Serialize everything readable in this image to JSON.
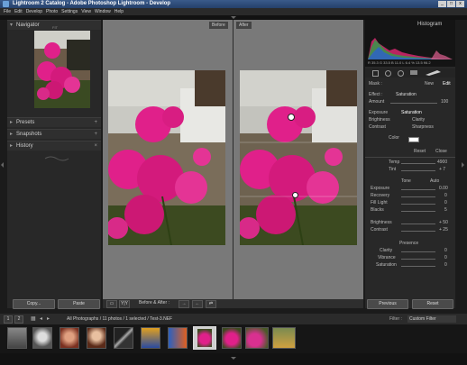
{
  "window": {
    "title": "Lightroom 2 Catalog - Adobe Photoshop Lightroom - Develop"
  },
  "menu": [
    "File",
    "Edit",
    "Develop",
    "Photo",
    "Settings",
    "View",
    "Window",
    "Help"
  ],
  "left_panel": {
    "navigator": {
      "label": "Navigator",
      "zoom": "FIT"
    },
    "sections": [
      {
        "label": "Presets"
      },
      {
        "label": "Snapshots"
      },
      {
        "label": "History"
      }
    ],
    "copy_label": "Copy...",
    "paste_label": "Paste"
  },
  "main": {
    "before_label": "Before",
    "after_label": "After"
  },
  "toolbar": {
    "compare_label": "Before & After :"
  },
  "right_panel": {
    "histogram_label": "Histogram",
    "histogram_readout": "R 35.3  G 33.5  B 11.0  L 6.4  % 13.5  f/6.2",
    "mask_label": "Mask :",
    "new_label": "New",
    "edit_label": "Edit",
    "effect_label": "Effect :",
    "effect_value": "Saturation",
    "amount_label": "Amount",
    "amount_value": "100",
    "brush_rows": [
      {
        "left": "Exposure",
        "right": "Saturation"
      },
      {
        "left": "Brightness",
        "right": "Clarity"
      },
      {
        "left": "Contrast",
        "right": "Sharpness"
      }
    ],
    "color_label": "Color",
    "reset_label": "Reset",
    "close_label": "Close",
    "temp_label": "Temp",
    "temp_value": "4900",
    "tint_label": "Tint",
    "tint_value": "+ 7",
    "tone_label": "Tone",
    "auto_label": "Auto",
    "tone_rows": [
      {
        "label": "Exposure",
        "value": "0.00"
      },
      {
        "label": "Recovery",
        "value": "0"
      },
      {
        "label": "Fill Light",
        "value": "0"
      },
      {
        "label": "Blacks",
        "value": "5"
      }
    ],
    "bright_rows": [
      {
        "label": "Brightness",
        "value": "+ 50"
      },
      {
        "label": "Contrast",
        "value": "+ 25"
      }
    ],
    "presence_label": "Presence",
    "presence_rows": [
      {
        "label": "Clarity",
        "value": "0"
      },
      {
        "label": "Vibrance",
        "value": "0"
      },
      {
        "label": "Saturation",
        "value": "0"
      }
    ],
    "previous_label": "Previous",
    "reset_button_label": "Reset"
  },
  "filmstrip": {
    "page1": "1",
    "page2": "2",
    "path_text": "All Photographs / 11 photos / 1 selected / Test-3.NEF",
    "filter_label": "Filter :",
    "filter_value": "Custom Filter"
  },
  "colors": {
    "accent": "#e0208a",
    "panel": "#282828",
    "main_bg": "#797979"
  }
}
